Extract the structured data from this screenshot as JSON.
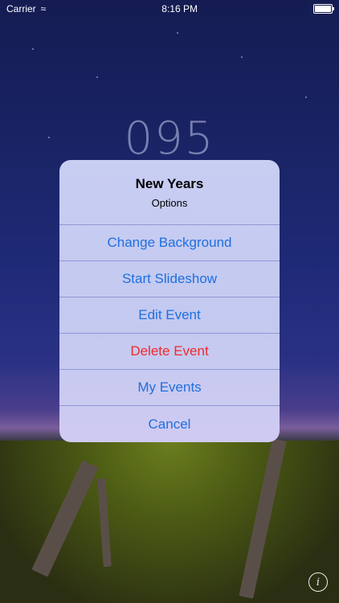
{
  "status_bar": {
    "carrier": "Carrier",
    "time": "8:16 PM"
  },
  "counter": "095",
  "sheet": {
    "title": "New Years",
    "subtitle": "Options",
    "actions": [
      {
        "label": "Change Background",
        "destructive": false
      },
      {
        "label": "Start Slideshow",
        "destructive": false
      },
      {
        "label": "Edit Event",
        "destructive": false
      },
      {
        "label": "Delete Event",
        "destructive": true
      },
      {
        "label": "My Events",
        "destructive": false
      },
      {
        "label": "Cancel",
        "destructive": false
      }
    ]
  },
  "colors": {
    "action": "#1f6fde",
    "destructive": "#f02a2a"
  },
  "info_button": {
    "icon": "info-icon",
    "glyph": "i"
  }
}
